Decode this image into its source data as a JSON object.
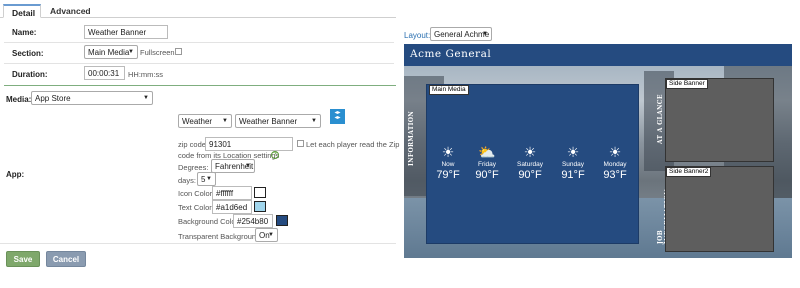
{
  "tabs": [
    {
      "label": "Detail",
      "active": true
    },
    {
      "label": "Advanced",
      "active": false
    }
  ],
  "form": {
    "name_label": "Name:",
    "name_value": "Weather Banner",
    "section_label": "Section:",
    "section_value": "Main Media",
    "fullscreen_label": "Fullscreen",
    "duration_label": "Duration:",
    "duration_value": "00:00:31",
    "duration_hint": "HH:mm:ss",
    "media_label": "Media:",
    "media_value": "App Store",
    "app_label": "App:"
  },
  "app": {
    "category_value": "Weather",
    "app_value": "Weather Banner",
    "zip_label": "zip code:",
    "zip_value": "91301",
    "zip_checkbox_text_1": "Let each player read the Zip",
    "zip_checkbox_text_2": "code from its Location settings",
    "degrees_label": "Degrees:",
    "degrees_value": "Fahrenheit",
    "days_label": "days:",
    "days_value": "5",
    "icon_color_label": "Icon Color:",
    "icon_color_value": "#ffffff",
    "text_color_label": "Text Color:",
    "text_color_value": "#a1d6ed",
    "bg_color_label": "Background Color:",
    "bg_color_value": "#254b80",
    "transparent_label": "Transparent Background:",
    "transparent_value": "On"
  },
  "buttons": {
    "save": "Save",
    "cancel": "Cancel"
  },
  "preview": {
    "layout_label": "Layout:",
    "layout_value": "General Achme",
    "header_title": "Acme General",
    "main_media_tag": "Main Media",
    "side_banner_tag": "Side Banner",
    "side_banner2_tag": "Side Banner2",
    "left_vertical_text": "INFORMATION",
    "right_vertical_text_1": "AT A GLANCE",
    "right_vertical_text_2": "JOB INFORMATION",
    "weather": [
      {
        "day": "Now",
        "temp": "79°F",
        "icon": "sun-icon"
      },
      {
        "day": "Friday",
        "temp": "90°F",
        "icon": "partly-cloudy-icon"
      },
      {
        "day": "Saturday",
        "temp": "90°F",
        "icon": "sun-icon"
      },
      {
        "day": "Sunday",
        "temp": "91°F",
        "icon": "sun-icon"
      },
      {
        "day": "Monday",
        "temp": "93°F",
        "icon": "sun-icon"
      }
    ]
  },
  "colors": {
    "accent_blue": "#254b80",
    "text_color_swatch": "#a1d6ed",
    "icon_color_swatch": "#ffffff",
    "save_button": "#7fa86b",
    "cancel_button": "#8a9bb0",
    "green_divider": "#7fae7f"
  }
}
